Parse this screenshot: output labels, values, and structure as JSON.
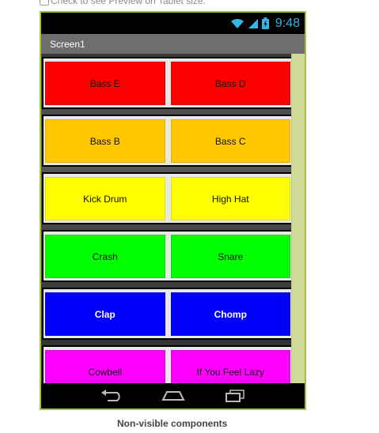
{
  "preview_checkbox": {
    "label": "Check to see Preview on Tablet size.",
    "checked": false
  },
  "status_bar": {
    "time": "9:48"
  },
  "screen": {
    "title": "Screen1"
  },
  "rows": [
    {
      "color": "#ff0000",
      "bold": false,
      "buttons": [
        "Bass E",
        "Bass D"
      ]
    },
    {
      "color": "#ffc800",
      "bold": false,
      "buttons": [
        "Bass B",
        "Bass C"
      ]
    },
    {
      "color": "#ffff00",
      "bold": false,
      "buttons": [
        "Kick Drum",
        "High Hat"
      ]
    },
    {
      "color": "#00ff00",
      "bold": false,
      "buttons": [
        "Crash",
        "Snare"
      ]
    },
    {
      "color": "#0000ff",
      "bold": true,
      "buttons": [
        "Clap",
        "Chomp"
      ]
    },
    {
      "color": "#ff00ff",
      "bold": false,
      "buttons": [
        "Cowbell",
        "If You Feel Lazy"
      ]
    }
  ],
  "icons": {
    "back": "back-icon",
    "home": "home-icon",
    "recents": "recents-icon"
  },
  "nonvisible_label": "Non-visible components"
}
